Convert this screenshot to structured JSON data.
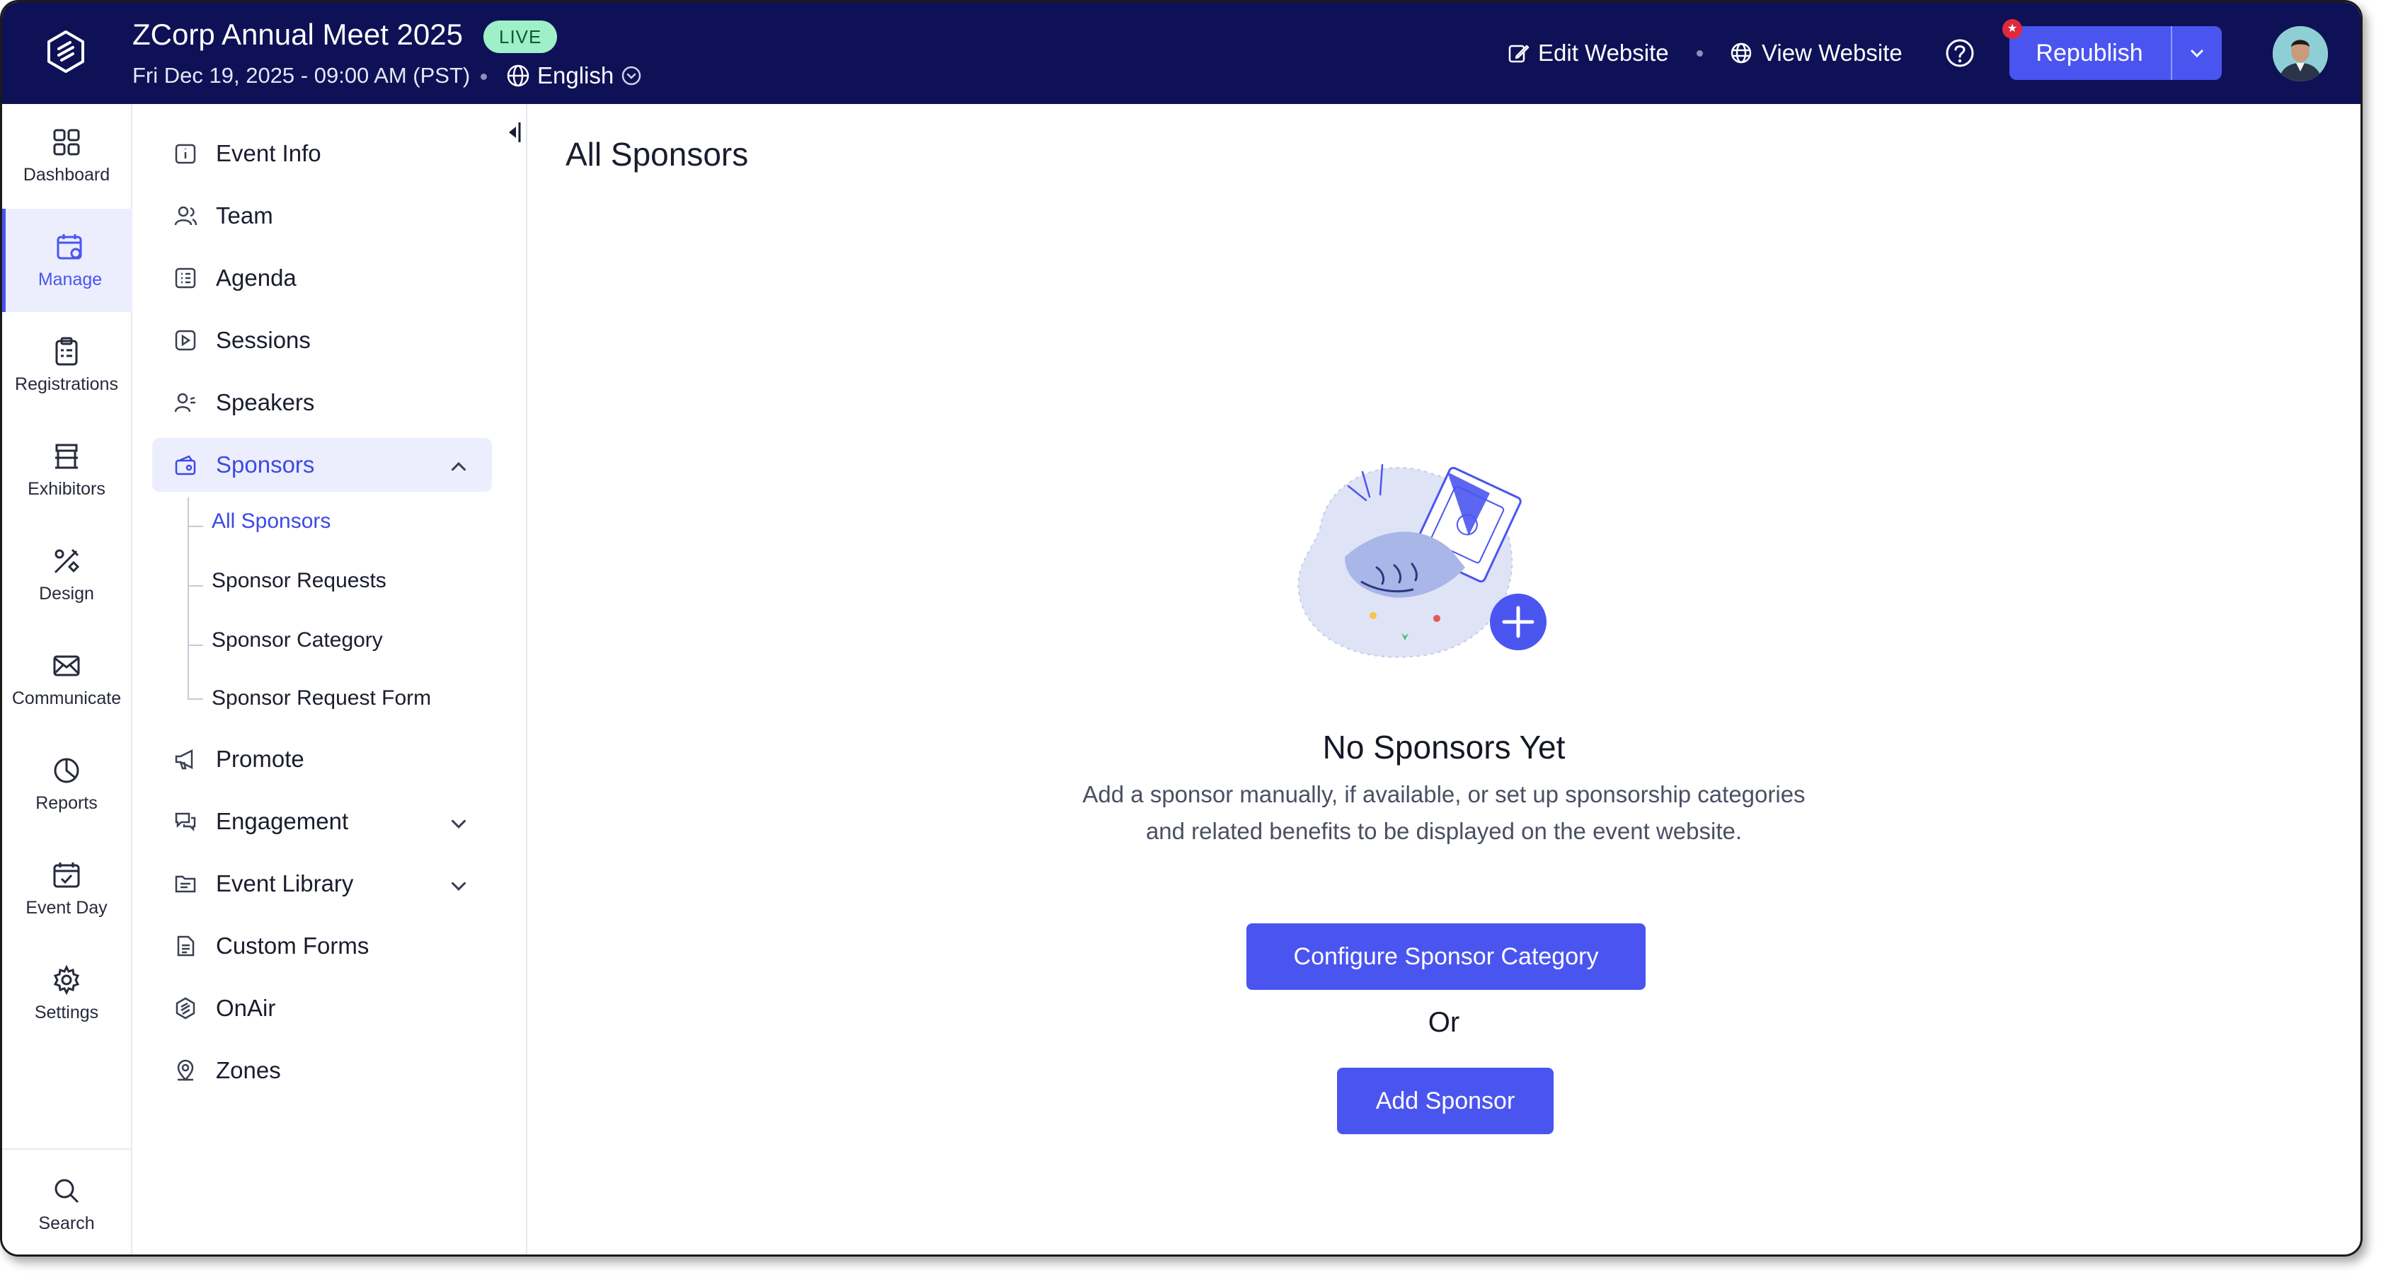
{
  "header": {
    "event_title": "ZCorp Annual Meet 2025",
    "live_badge": "LIVE",
    "event_datetime": "Fri Dec 19, 2025 - 09:00 AM (PST)",
    "language": "English",
    "edit_website": "Edit Website",
    "view_website": "View Website",
    "republish": "Republish",
    "notification_mark": "★"
  },
  "rail": {
    "items": [
      {
        "label": "Dashboard",
        "icon": "grid-icon"
      },
      {
        "label": "Manage",
        "icon": "calendar-gear-icon"
      },
      {
        "label": "Registrations",
        "icon": "clipboard-icon"
      },
      {
        "label": "Exhibitors",
        "icon": "booth-icon"
      },
      {
        "label": "Design",
        "icon": "design-tools-icon"
      },
      {
        "label": "Communicate",
        "icon": "mail-icon"
      },
      {
        "label": "Reports",
        "icon": "pie-chart-icon"
      },
      {
        "label": "Event Day",
        "icon": "calendar-check-icon"
      },
      {
        "label": "Settings",
        "icon": "gear-icon"
      }
    ],
    "search": "Search",
    "active": "Manage"
  },
  "subnav": {
    "items": [
      {
        "label": "Event Info"
      },
      {
        "label": "Team"
      },
      {
        "label": "Agenda"
      },
      {
        "label": "Sessions"
      },
      {
        "label": "Speakers"
      },
      {
        "label": "Sponsors"
      },
      {
        "label": "Promote"
      },
      {
        "label": "Engagement"
      },
      {
        "label": "Event Library"
      },
      {
        "label": "Custom Forms"
      },
      {
        "label": "OnAir"
      },
      {
        "label": "Zones"
      }
    ],
    "sponsors_children": [
      {
        "label": "All Sponsors"
      },
      {
        "label": "Sponsor Requests"
      },
      {
        "label": "Sponsor Category"
      },
      {
        "label": "Sponsor Request Form"
      }
    ]
  },
  "main": {
    "page_title": "All Sponsors",
    "empty_title": "No Sponsors Yet",
    "empty_desc_line1": "Add a sponsor manually, if available, or set up sponsorship categories",
    "empty_desc_line2": "and related benefits to be displayed on the event website.",
    "configure_button": "Configure Sponsor Category",
    "or_text": "Or",
    "add_button": "Add Sponsor"
  },
  "colors": {
    "header_bg": "#0f1156",
    "accent": "#4a55f0",
    "live_badge_bg": "#9ff0c8",
    "active_bg": "#eceefe"
  }
}
